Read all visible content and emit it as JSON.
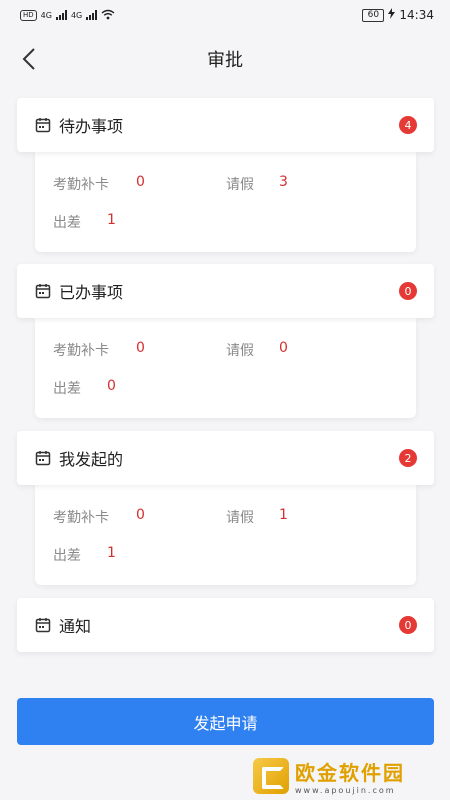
{
  "status_bar": {
    "left_chip": "HD",
    "network_1": "4G",
    "network_2": "4G",
    "battery": "60",
    "time": "14:34"
  },
  "header": {
    "title": "审批",
    "back_icon": "chevron-left-icon"
  },
  "sections": [
    {
      "title": "待办事项",
      "badge": "4",
      "icon": "calendar-icon",
      "stats": {
        "attendance_label": "考勤补卡",
        "attendance_value": "0",
        "leave_label": "请假",
        "leave_value": "3",
        "trip_label": "出差",
        "trip_value": "1"
      }
    },
    {
      "title": "已办事项",
      "badge": "0",
      "icon": "calendar-icon",
      "stats": {
        "attendance_label": "考勤补卡",
        "attendance_value": "0",
        "leave_label": "请假",
        "leave_value": "0",
        "trip_label": "出差",
        "trip_value": "0"
      }
    },
    {
      "title": "我发起的",
      "badge": "2",
      "icon": "calendar-icon",
      "stats": {
        "attendance_label": "考勤补卡",
        "attendance_value": "0",
        "leave_label": "请假",
        "leave_value": "1",
        "trip_label": "出差",
        "trip_value": "1"
      }
    },
    {
      "title": "通知",
      "badge": "0",
      "icon": "calendar-icon"
    }
  ],
  "submit_button": "发起申请",
  "watermark": {
    "name": "欧金软件园",
    "url": "www.apoujin.com"
  },
  "colors": {
    "accent": "#2f80f0",
    "badge": "#e53935",
    "value": "#d32f2f"
  }
}
